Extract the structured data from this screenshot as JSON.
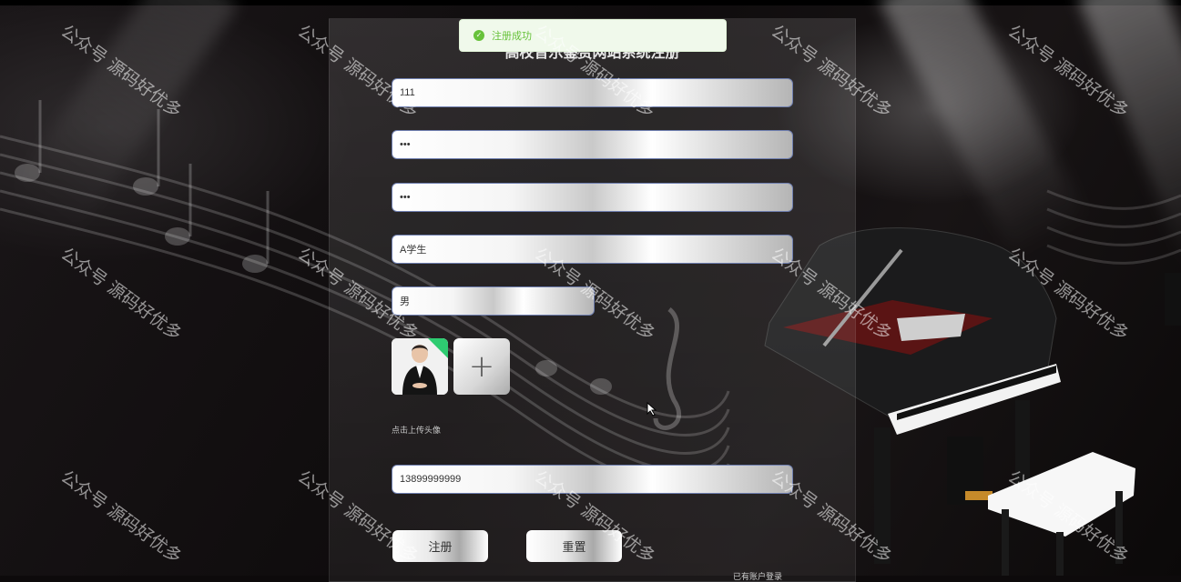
{
  "form": {
    "title": "高校音乐鉴赏网站系统注册",
    "username_value": "111",
    "password_value": "•••",
    "confirm_password_value": "•••",
    "name_value": "A学生",
    "gender_value": "男",
    "upload_plus": "+",
    "upload_hint": "点击上传头像",
    "phone_value": "13899999999",
    "register_label": "注册",
    "reset_label": "重置",
    "login_link": "已有账户登录"
  },
  "toast": {
    "message": "注册成功",
    "icon": "check-circle-icon",
    "color": "#67c23a"
  },
  "watermark": {
    "text": "公众号 源码好优多"
  }
}
